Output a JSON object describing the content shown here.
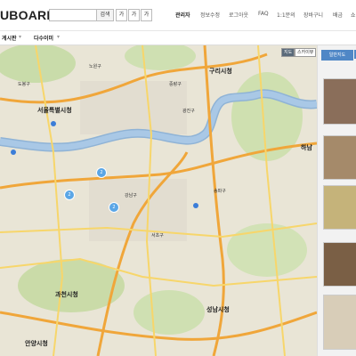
{
  "header": {
    "logo": "UBOARDS",
    "search_button": "검색",
    "font_buttons": [
      "가",
      "가",
      "가"
    ],
    "nav": [
      "관리자",
      "정보수정",
      "로그아웃",
      "FAQ",
      "1:1문의",
      "장바구니",
      "배금",
      "쇼"
    ]
  },
  "subnav": {
    "items": [
      "게시판",
      "다수이미"
    ]
  },
  "map": {
    "type_buttons": [
      "지도",
      "스카이뷰"
    ],
    "labels": {
      "seoul": "서울특별시청",
      "guri": "구리시청",
      "gwacheon": "과천시청",
      "seongnam": "성남시청",
      "anyang": "안양시청",
      "hanam": "하남",
      "gangnam": "강남구",
      "songpa": "송파구",
      "seocho": "서초구",
      "gwangjin": "광진구",
      "jungnang": "중랑구",
      "nowon": "노원구",
      "dobong": "도봉구"
    },
    "pins": [
      "2",
      "2",
      "2"
    ]
  },
  "sidebar": {
    "tab_label": "일반지도",
    "thumb_colors": [
      "#8a6e5a",
      "#a58a6a",
      "#c5b37a",
      "#7a5f45",
      "#d8cdb8"
    ]
  }
}
